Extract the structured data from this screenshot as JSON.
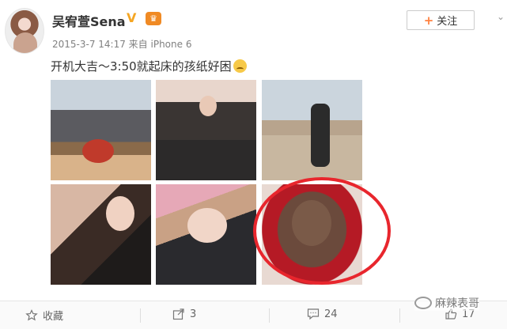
{
  "user": {
    "name": "吴宥萱Sena",
    "verified_mark": "V",
    "time_source": "2015-3-7 14:17 来自 iPhone 6"
  },
  "follow": {
    "plus": "+",
    "label": "关注"
  },
  "post": {
    "text": "开机大吉～3:50就起床的孩纸好困"
  },
  "photos": 6,
  "actions": {
    "favorite": "收藏",
    "share_count": "3",
    "comment_count": "24",
    "like_count": "17"
  },
  "watermark": "麻辣表哥",
  "colors": {
    "accent": "#ff8140",
    "highlight": "#e8262d",
    "verified": "#f5a623"
  }
}
